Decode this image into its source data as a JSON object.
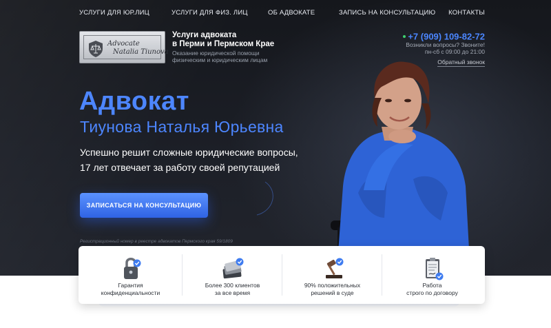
{
  "nav": {
    "items": [
      "УСЛУГИ ДЛЯ ЮР.ЛИЦ",
      "УСЛУГИ ДЛЯ ФИЗ. ЛИЦ",
      "ОБ АДВОКАТЕ",
      "ЗАПИСЬ НА КОНСУЛЬТАЦИЮ",
      "КОНТАКТЫ"
    ]
  },
  "logo": {
    "line1": "Advocate",
    "line2": "Natalia Tiunova"
  },
  "brand": {
    "title_line1": "Услуги адвоката",
    "title_line2": "в Перми и Пермском Крае",
    "sub_line1": "Оказание юридической помощи",
    "sub_line2": "физическим и юридическим лицам"
  },
  "contacts": {
    "phone": "+7 (909) 109-82-72",
    "question": "Возникли вопросы? Звоните!",
    "hours": "пн-сб с 09:00 до 21:00",
    "callback": "Обратный звонок"
  },
  "hero": {
    "title": "Адвокат",
    "name": "Тиунова Наталья Юрьевна",
    "desc_line1": "Успешно решит сложные юридические вопросы,",
    "desc_line2": "17 лет отвечает за работу своей репутацией",
    "cta": "ЗАПИСАТЬСЯ НА КОНСУЛЬТАЦИЮ",
    "reg_note": "Регистрационный номер в реестре адвокатов Пермского края 59/1809"
  },
  "features": [
    {
      "icon": "padlock-icon",
      "line1": "Гарантия",
      "line2": "конфиденциальности"
    },
    {
      "icon": "folders-icon",
      "line1": "Более 300 клиентов",
      "line2": "за все время"
    },
    {
      "icon": "gavel-icon",
      "line1": "90% положительных",
      "line2": "решений в суде"
    },
    {
      "icon": "contract-icon",
      "line1": "Работа",
      "line2": "строго по договору"
    }
  ],
  "colors": {
    "accent": "#4d86ff",
    "cta": "#3a6ff0",
    "hero_bg": "#1a1d24",
    "online": "#3fd06f",
    "check_badge": "#3f7cf0"
  }
}
